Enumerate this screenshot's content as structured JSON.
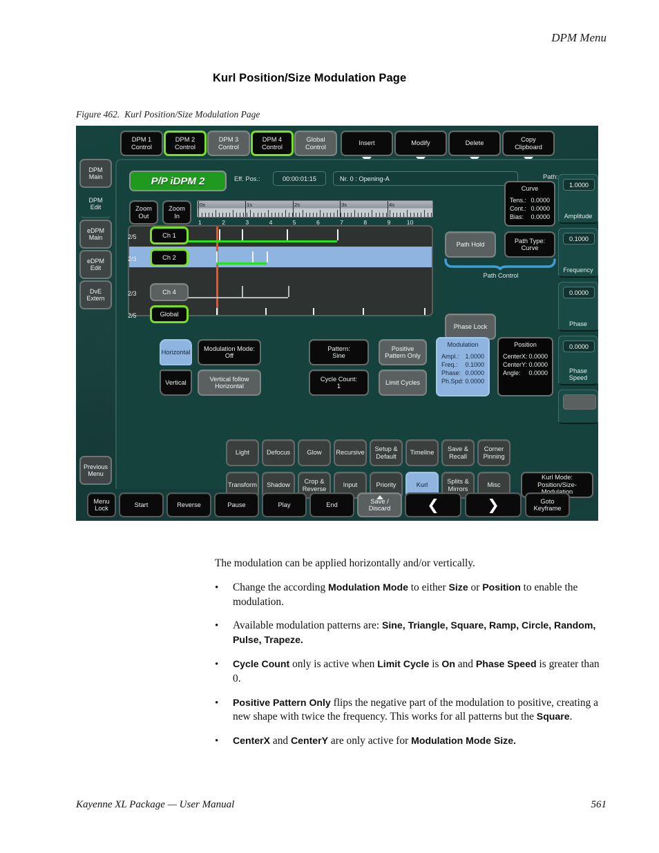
{
  "document": {
    "running_head": "DPM Menu",
    "title": "Kurl Position/Size Modulation Page",
    "figure_number": "Figure 462.",
    "figure_caption": "Kurl Position/Size Modulation Page",
    "footer_left": "Kayenne XL Package  —  User Manual",
    "page_number": "561"
  },
  "body": {
    "intro": "The modulation can be applied horizontally and/or vertically.",
    "bullets": [
      {
        "marker": "•",
        "parts": [
          {
            "t": "Change the according ",
            "b": false
          },
          {
            "t": "Modulation Mode",
            "b": true
          },
          {
            "t": " to either ",
            "b": false
          },
          {
            "t": "Size",
            "b": true
          },
          {
            "t": " or ",
            "b": false
          },
          {
            "t": "Position",
            "b": true
          },
          {
            "t": " to enable the modulation.",
            "b": false
          }
        ]
      },
      {
        "marker": "•",
        "parts": [
          {
            "t": "Available modulation patterns are: ",
            "b": false
          },
          {
            "t": "Sine, Triangle, Square, Ramp, Circle, Random, Pulse, Trapeze.",
            "b": true
          }
        ]
      },
      {
        "marker": "•",
        "parts": [
          {
            "t": "Cycle Count",
            "b": true
          },
          {
            "t": " only is active when ",
            "b": false
          },
          {
            "t": "Limit Cycle",
            "b": true
          },
          {
            "t": " is ",
            "b": false
          },
          {
            "t": "On",
            "b": true
          },
          {
            "t": " and ",
            "b": false
          },
          {
            "t": "Phase Speed",
            "b": true
          },
          {
            "t": " is greater than 0.",
            "b": false
          }
        ]
      },
      {
        "marker": "•",
        "parts": [
          {
            "t": "Positive Pattern Only",
            "b": true
          },
          {
            "t": " flips the negative part of the modulation to positive, creating a new shape with twice the frequency. This works for all patterns but the ",
            "b": false
          },
          {
            "t": "Square",
            "b": true
          },
          {
            "t": ".",
            "b": false
          }
        ]
      },
      {
        "marker": "•",
        "parts": [
          {
            "t": "CenterX",
            "b": true
          },
          {
            "t": " and ",
            "b": false
          },
          {
            "t": "CenterY",
            "b": true
          },
          {
            "t": " are only active for ",
            "b": false
          },
          {
            "t": "Modulation Mode Size.",
            "b": true
          }
        ]
      }
    ]
  },
  "ui": {
    "colors": {
      "panel_bg": "#16403c",
      "button_black": "#0a0a0a",
      "button_grey": "#5a605f",
      "select_green": "#79e022",
      "select_blue": "#8fb4e0",
      "playhead_orange": "#ff4d17",
      "keyframe_green": "#29e020",
      "chip_green": "#1f9a1f",
      "brace_blue": "#3e9fd8"
    },
    "top_row": [
      {
        "label": "DPM 1\nControl",
        "state": "normal",
        "dropdown": false
      },
      {
        "label": "DPM 2\nControl",
        "state": "selected",
        "dropdown": false
      },
      {
        "label": "DPM 3\nControl",
        "state": "grey",
        "dropdown": false
      },
      {
        "label": "DPM 4\nControl",
        "state": "selected",
        "dropdown": false
      },
      {
        "label": "Global\nControl",
        "state": "grey",
        "dropdown": false
      },
      {
        "label": "Insert",
        "state": "normal",
        "dropdown": true
      },
      {
        "label": "Modify",
        "state": "normal",
        "dropdown": true
      },
      {
        "label": "Delete",
        "state": "normal",
        "dropdown": true
      },
      {
        "label": "Copy\nClipboard",
        "state": "normal",
        "dropdown": true
      }
    ],
    "sidebar": [
      {
        "label": "DPM\nMain",
        "active": false
      },
      {
        "label": "DPM\nEdit",
        "active": true
      },
      {
        "label": "eDPM\nMain",
        "active": false
      },
      {
        "label": "eDPM\nEdit",
        "active": false
      },
      {
        "label": "DvE\nExtern",
        "active": false
      },
      {
        "label": "Previous\nMenu",
        "active": false
      }
    ],
    "header": {
      "chip": "P/P iDPM 2",
      "eff_pos_label": "Eff. Pos.:",
      "eff_pos_value": "00:00:01:15",
      "keyframe_field": "Nr. 0 :   Opening-A"
    },
    "zoom": {
      "out": "Zoom\nOut",
      "in": "Zoom\nIn"
    },
    "ruler": {
      "labels": [
        "0s",
        "1s",
        "2s",
        "3s",
        "4s"
      ],
      "frame_numbers": [
        "1",
        "2",
        "3",
        "4",
        "5",
        "6",
        "7",
        "8",
        "9",
        "10"
      ]
    },
    "tracks": [
      {
        "ratio": "2/5",
        "name": "Ch 1",
        "state": "selected",
        "selected_row": false
      },
      {
        "ratio": "2/3",
        "name": "Ch 2",
        "state": "selected",
        "selected_row": true
      },
      {
        "ratio": "2/3",
        "name": "Ch 4",
        "state": "grey",
        "selected_row": false
      },
      {
        "ratio": "2/5",
        "name": "Global",
        "state": "selected",
        "selected_row": false
      }
    ],
    "path": {
      "title": "Path: Kurl",
      "curve_box": {
        "title": "Curve",
        "rows": [
          {
            "k": "Tens.:",
            "v": "0.0000"
          },
          {
            "k": "Cont.:",
            "v": "0.0000"
          },
          {
            "k": "Bias:",
            "v": "0.0000"
          }
        ]
      },
      "path_hold": "Path Hold",
      "path_type": "Path Type:\nCurve",
      "path_control_caption": "Path Control",
      "phase_lock": "Phase Lock"
    },
    "modulation_controls": {
      "horizontal": "Horizontal",
      "vertical": "Vertical",
      "modulation_mode": "Modulation Mode:\nOff",
      "vertical_follow": "Vertical follow\nHorizontal",
      "pattern": "Pattern:\nSine",
      "cycle_count": "Cycle Count:\n1",
      "positive_pattern_only": "Positive\nPattern Only",
      "limit_cycles": "Limit Cycles",
      "modulation_box": {
        "title": "Modulation",
        "rows": [
          {
            "k": "Ampl.:",
            "v": "1.0000"
          },
          {
            "k": "Freq.:",
            "v": "0.1000"
          },
          {
            "k": "Phase:",
            "v": "0.0000"
          },
          {
            "k": "Ph.Spd:",
            "v": "0.0000"
          }
        ]
      },
      "position_box": {
        "title": "Position",
        "rows": [
          {
            "k": "CenterX:",
            "v": "0.0000"
          },
          {
            "k": "CenterY:",
            "v": "0.0000"
          },
          {
            "k": "Angle:",
            "v": "0.0000"
          }
        ]
      }
    },
    "function_row_1": [
      "Light",
      "Defocus",
      "Glow",
      "Recursive",
      "Setup &\nDefault",
      "Timeline",
      "Save &\nRecall",
      "Corner\nPinning"
    ],
    "function_row_2": [
      {
        "label": "Transform",
        "state": "soft"
      },
      {
        "label": "Shadow",
        "state": "soft"
      },
      {
        "label": "Crop &\nReverse",
        "state": "soft"
      },
      {
        "label": "Input",
        "state": "soft"
      },
      {
        "label": "Priority",
        "state": "soft"
      },
      {
        "label": "Kurl",
        "state": "blue"
      },
      {
        "label": "Splits &\nMirrors",
        "state": "soft"
      },
      {
        "label": "Misc",
        "state": "soft"
      }
    ],
    "kurl_mode_button": "Kurl Mode:\nPosition/Size-\nModulation",
    "rail": [
      {
        "value": "1.0000",
        "name": "Amplitude"
      },
      {
        "value": "0.1000",
        "name": "Frequency"
      },
      {
        "value": "0.0000",
        "name": "Phase"
      },
      {
        "value": "0.0000",
        "name": "Phase\nSpeed"
      },
      {
        "value": "",
        "name": ""
      }
    ],
    "transport": [
      {
        "label": "Menu\nLock",
        "style": "plain",
        "icon": ""
      },
      {
        "label": "Start",
        "style": "plain",
        "icon": ""
      },
      {
        "label": "Reverse",
        "style": "plain",
        "icon": ""
      },
      {
        "label": "Pause",
        "style": "plain",
        "icon": ""
      },
      {
        "label": "Play",
        "style": "plain",
        "icon": ""
      },
      {
        "label": "End",
        "style": "plain",
        "icon": ""
      },
      {
        "label": "Save /\nDiscard",
        "style": "grey",
        "icon": "up-triangle"
      },
      {
        "label": "",
        "style": "plain",
        "icon": "chevron-left"
      },
      {
        "label": "",
        "style": "plain",
        "icon": "chevron-right"
      },
      {
        "label": "Goto\nKeyframe",
        "style": "plain",
        "icon": ""
      }
    ]
  }
}
